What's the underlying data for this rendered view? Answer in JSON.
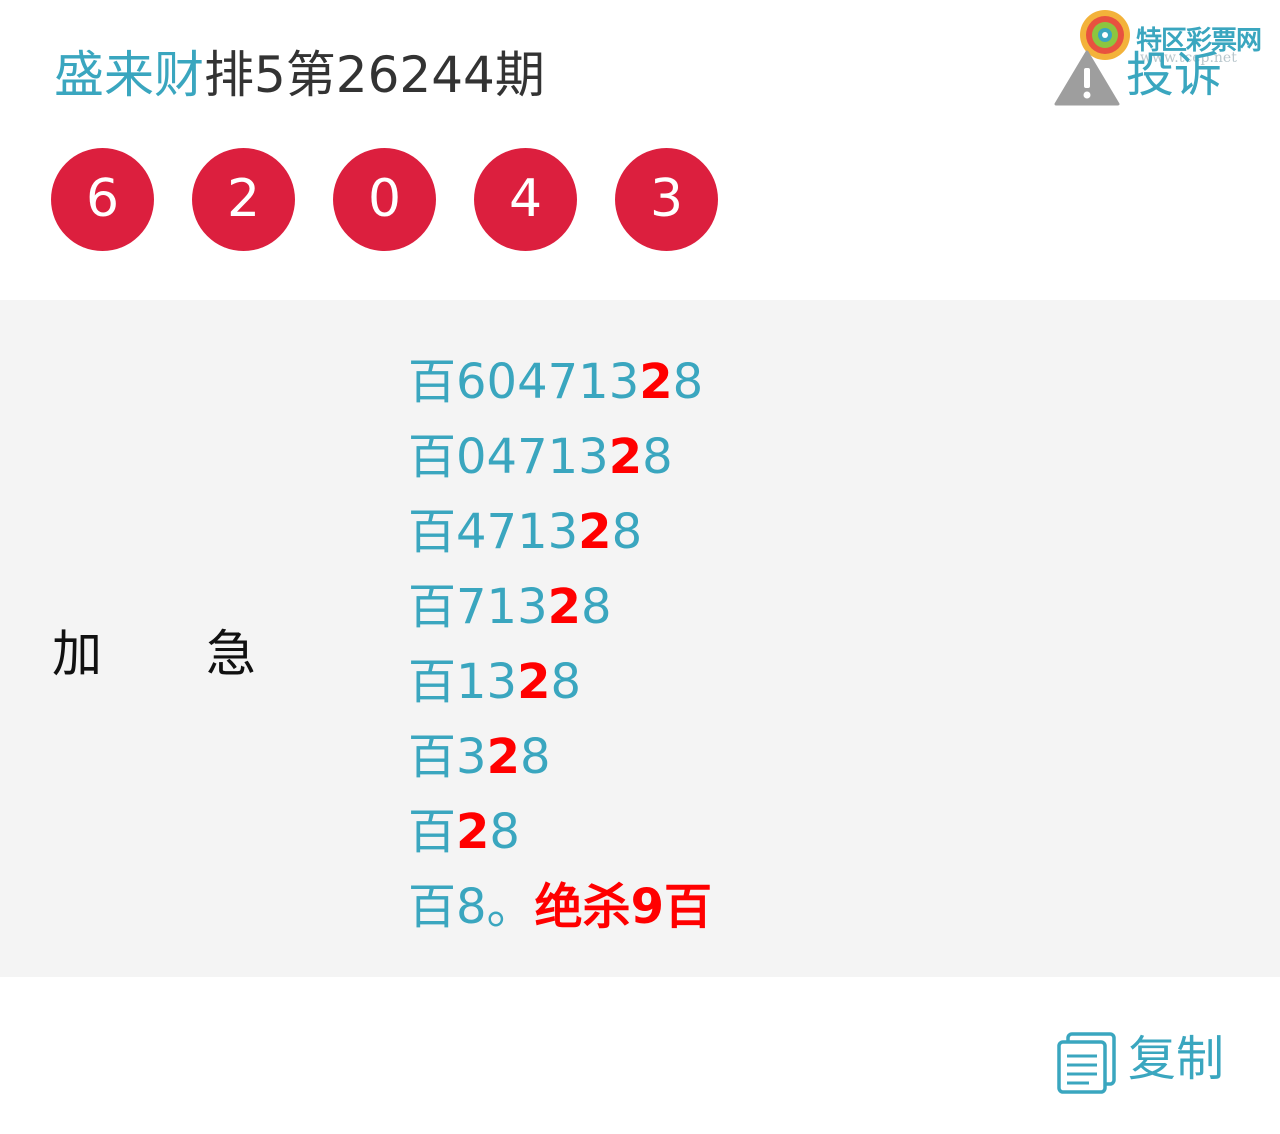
{
  "header": {
    "author": "盛来财",
    "title_rest": "排5第26244期",
    "complain_label": "投诉"
  },
  "watermark": {
    "name": "特区彩票网",
    "url": "www.tcep.net"
  },
  "balls": [
    "6",
    "2",
    "0",
    "4",
    "3"
  ],
  "side_label": [
    "加",
    "急"
  ],
  "predictions": [
    {
      "prefix": "百",
      "before": "604713",
      "highlight": "2",
      "after": "8",
      "suffix": ""
    },
    {
      "prefix": "百",
      "before": "04713",
      "highlight": "2",
      "after": "8",
      "suffix": ""
    },
    {
      "prefix": "百",
      "before": "4713",
      "highlight": "2",
      "after": "8",
      "suffix": ""
    },
    {
      "prefix": "百",
      "before": "713",
      "highlight": "2",
      "after": "8",
      "suffix": ""
    },
    {
      "prefix": "百",
      "before": "13",
      "highlight": "2",
      "after": "8",
      "suffix": ""
    },
    {
      "prefix": "百",
      "before": "3",
      "highlight": "2",
      "after": "8",
      "suffix": ""
    },
    {
      "prefix": "百",
      "before": "",
      "highlight": "2",
      "after": "8",
      "suffix": ""
    },
    {
      "prefix": "百",
      "before": "8。",
      "highlight": "",
      "after": "",
      "suffix": "绝杀9百"
    }
  ],
  "copy_label": "复制",
  "colors": {
    "accent": "#3aa6bf",
    "ball": "#dc1f3e",
    "highlight": "#ff0000",
    "panel": "#f4f4f4"
  }
}
